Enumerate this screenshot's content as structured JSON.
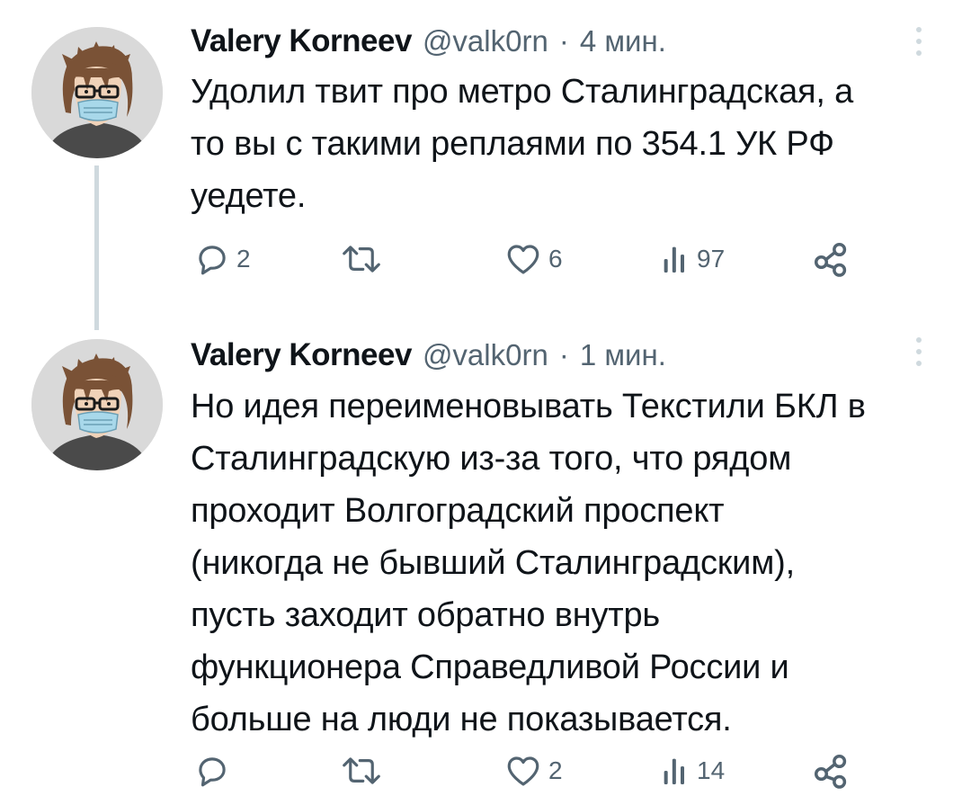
{
  "tweets": [
    {
      "author_name": "Valery Korneev",
      "handle": "@valk0rn",
      "separator": "·",
      "time": "4 мин.",
      "text_lines": [
        "Удолил твит про метро Сталинградская, а",
        "то вы с такими реплаями по 354.1 УК РФ",
        "уедете."
      ],
      "replies": "2",
      "retweets": "",
      "likes": "6",
      "views": "97"
    },
    {
      "author_name": "Valery Korneev",
      "handle": "@valk0rn",
      "separator": "·",
      "time": "1 мин.",
      "text_lines": [
        "Но идея переименовывать Текстили БКЛ в",
        "Сталинградскую из-за того, что рядом",
        "проходит Волгоградский проспект",
        "(никогда не бывший Сталинградским),",
        "пусть заходит обратно внутрь",
        "функционера Справедливой России и",
        "больше на люди не показывается."
      ],
      "replies": "",
      "retweets": "",
      "likes": "2",
      "views": "14"
    }
  ],
  "icons": {
    "reply": "reply-icon",
    "retweet": "retweet-icon",
    "like": "heart-icon",
    "views": "views-icon",
    "share": "share-icon",
    "more": "more-vertical-icon"
  },
  "colors": {
    "text": "#0f1419",
    "secondary": "#536471",
    "thread_line": "#cfd9de",
    "background": "#ffffff"
  }
}
